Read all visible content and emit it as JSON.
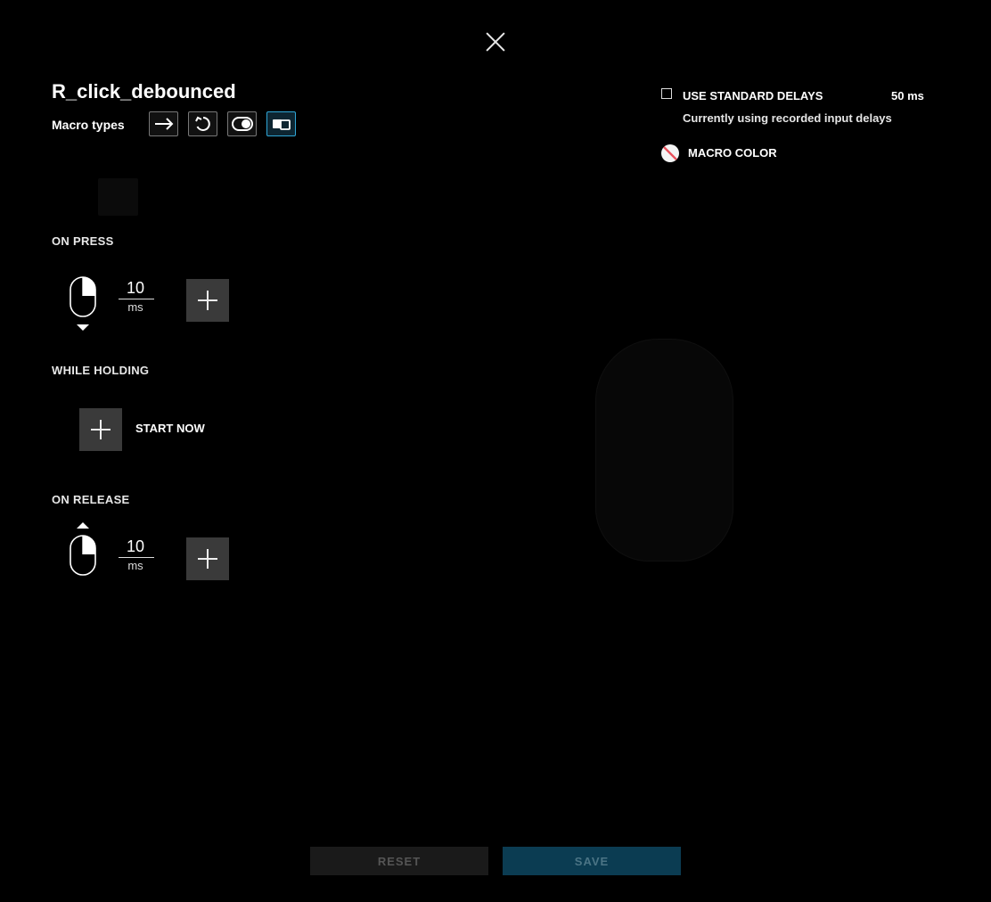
{
  "macro": {
    "name": "R_click_debounced",
    "types_label": "Macro types",
    "types": [
      {
        "icon": "arrow-right-icon",
        "active": false
      },
      {
        "icon": "repeat-icon",
        "active": false
      },
      {
        "icon": "toggle-icon",
        "active": false
      },
      {
        "icon": "sequence-icon",
        "active": true
      }
    ]
  },
  "sections": {
    "on_press": {
      "label": "ON PRESS",
      "delay": "10",
      "unit": "ms"
    },
    "while_holding": {
      "label": "WHILE HOLDING",
      "action": "START NOW"
    },
    "on_release": {
      "label": "ON RELEASE",
      "delay": "10",
      "unit": "ms"
    }
  },
  "settings": {
    "standard_delays_label": "USE STANDARD DELAYS",
    "standard_delays_checked": false,
    "standard_delay_value": "50 ms",
    "delay_note": "Currently using recorded input delays",
    "macro_color_label": "MACRO COLOR"
  },
  "footer": {
    "reset_label": "RESET",
    "save_label": "SAVE"
  },
  "colors": {
    "accent": "#2fa6d6",
    "save_bg": "#0b3c52",
    "no_color": "#e8505b"
  }
}
